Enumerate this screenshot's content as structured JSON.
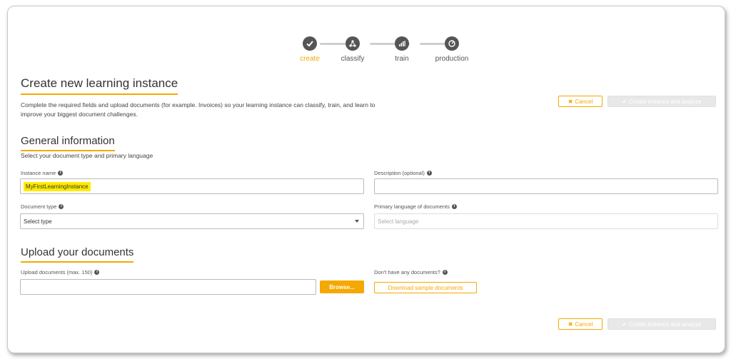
{
  "stepper": {
    "steps": [
      {
        "label": "create",
        "icon": "check-icon",
        "active": true
      },
      {
        "label": "classify",
        "icon": "network-icon",
        "active": false
      },
      {
        "label": "train",
        "icon": "bars-icon",
        "active": false
      },
      {
        "label": "production",
        "icon": "gauge-icon",
        "active": false
      }
    ]
  },
  "header": {
    "title": "Create new learning instance",
    "description": "Complete the required fields and upload documents (for example. Invoices) so your learning instance can classify, train, and learn to improve your biggest document challenges."
  },
  "actions": {
    "cancel_label": "Cancel",
    "create_label": "Create instance and analyze"
  },
  "general": {
    "title": "General information",
    "subtitle": "Select your document type and primary language",
    "instance_name_label": "Instance name",
    "instance_name_value": "MyFirstLearningInstance",
    "description_label": "Description (optional)",
    "description_value": "",
    "document_type_label": "Document type",
    "document_type_value": "Select type",
    "language_label": "Primary language of documents",
    "language_placeholder": "Select language"
  },
  "upload": {
    "title": "Upload your documents",
    "upload_label": "Upload documents (max. 150)",
    "browse_label": "Browse...",
    "no_docs_label": "Don't have any documents?",
    "sample_label": "Download sample documents"
  },
  "colors": {
    "accent": "#f5a800",
    "highlight": "#ffeb00",
    "step_icon": "#555555"
  }
}
